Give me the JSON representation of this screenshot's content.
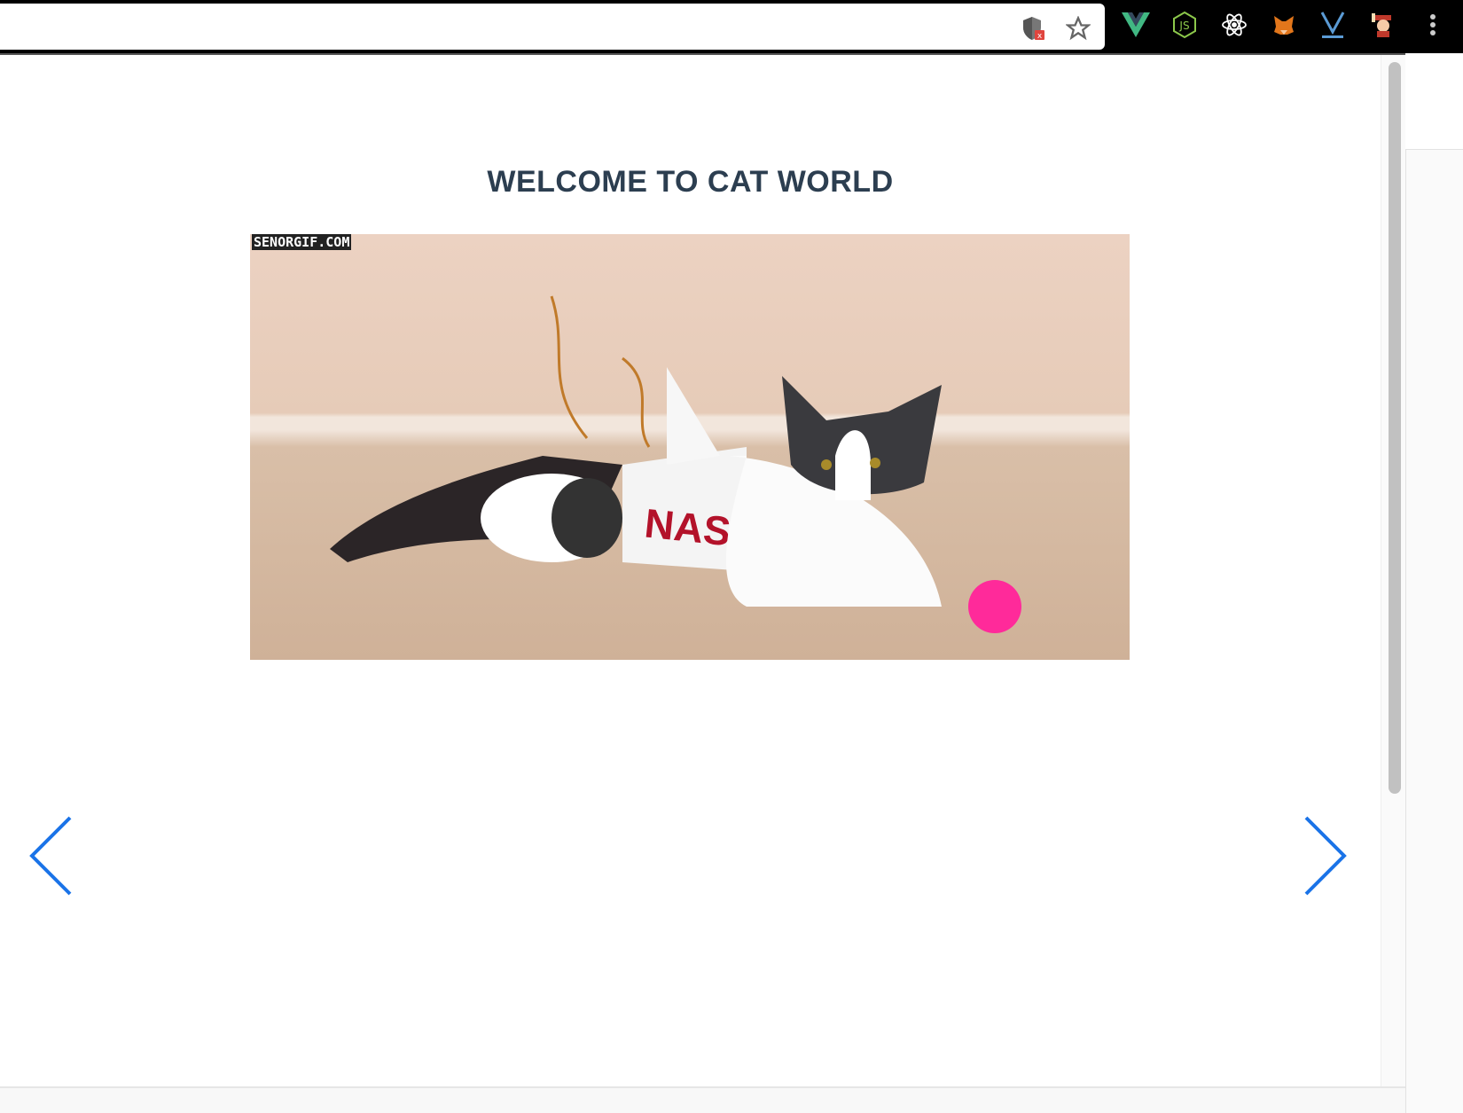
{
  "browser": {
    "toolbar_icons": [
      "shield-blocked-icon",
      "star-bookmark-icon"
    ],
    "extensions": [
      "vue-devtools-icon",
      "nodejs-icon",
      "react-devtools-icon",
      "metamask-icon",
      "vuetify-icon",
      "avatar-extension-icon",
      "more-menu-icon"
    ]
  },
  "page": {
    "title": "WELCOME TO CAT WORLD",
    "image_watermark": "SENORGIF.COM",
    "image_text": "NASA"
  },
  "colors": {
    "accent": "#1a73e8",
    "title": "#2c3e50"
  }
}
